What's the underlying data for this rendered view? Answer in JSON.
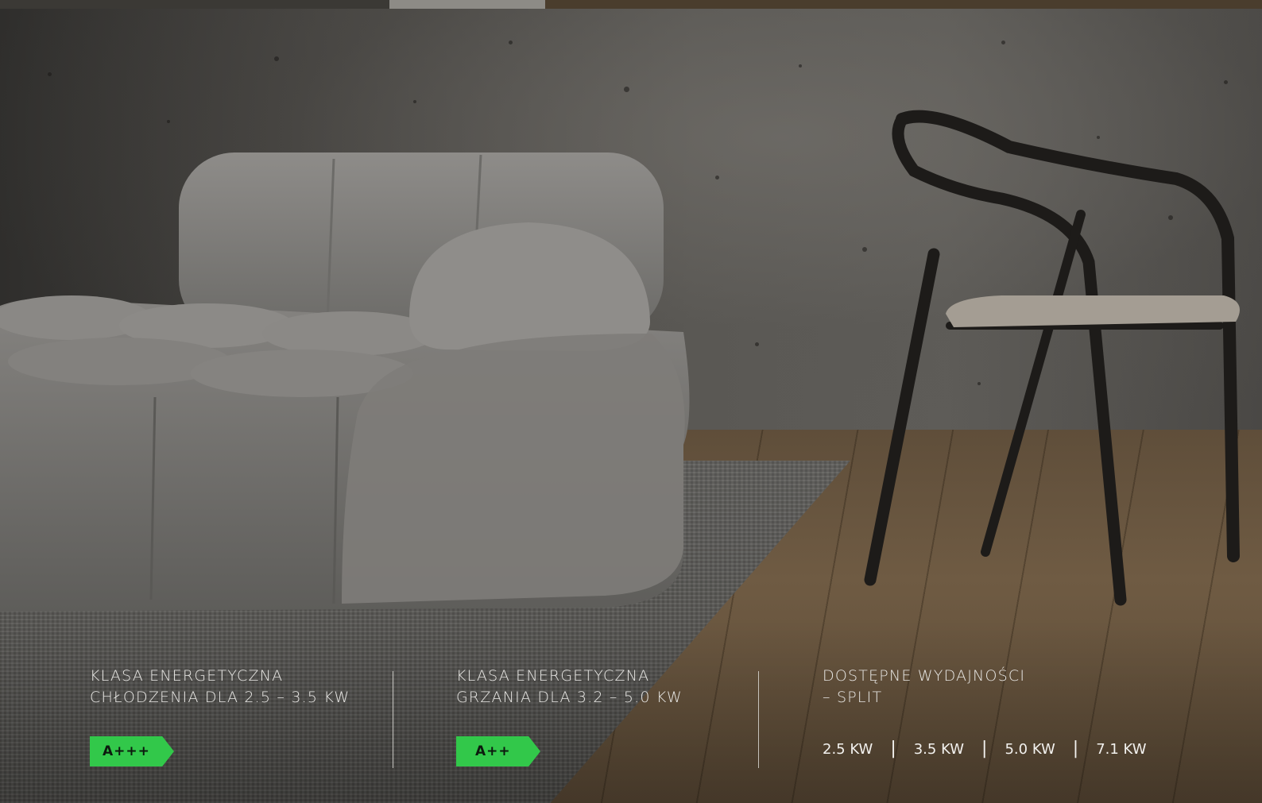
{
  "info_panel": {
    "cooling": {
      "heading_line_1": "KLASA ENERGETYCZNA",
      "heading_line_2": "CHŁODZENIA DLA 2.5 – 3.5 KW",
      "badge": "A+++"
    },
    "heating": {
      "heading_line_1": "KLASA ENERGETYCZNA",
      "heading_line_2": "GRZANIA DLA 3.2 – 5.0 KW",
      "badge": "A++"
    },
    "capacities": {
      "heading_line_1": "DOSTĘPNE WYDAJNOŚCI",
      "heading_line_2": "– SPLIT",
      "items": [
        "2.5 KW",
        "3.5 KW",
        "5.0 KW",
        "7.1 KW"
      ],
      "separator": "|"
    }
  },
  "colors": {
    "badge_green": "#32c84a",
    "text_light": "#e8e7e4",
    "background_dark": "#2f2e2c"
  }
}
